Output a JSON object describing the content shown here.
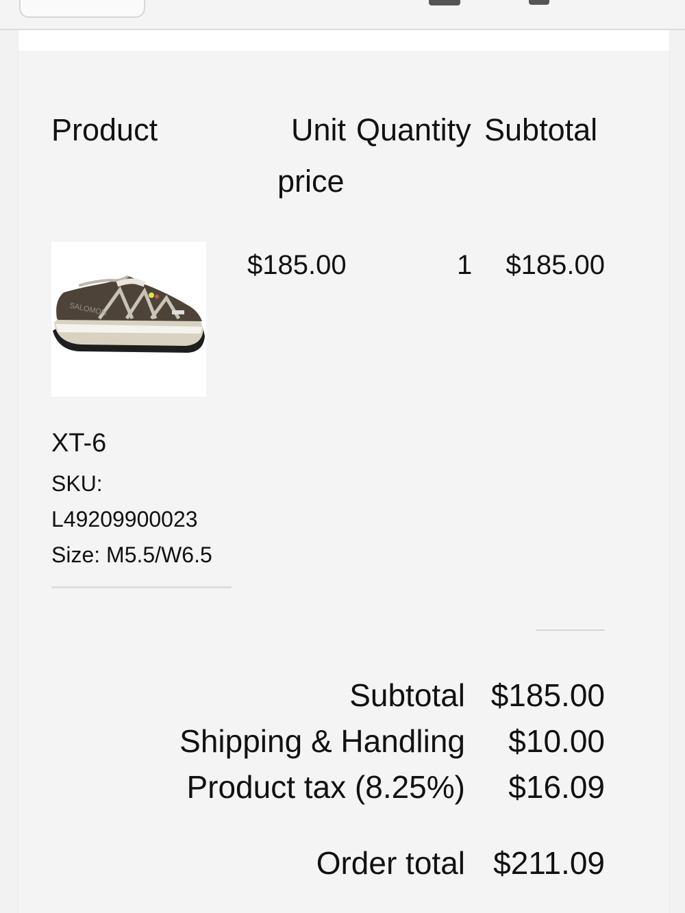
{
  "table": {
    "headers": {
      "product": "Product",
      "unit_price_line1": "Unit",
      "unit_price_line2": "price",
      "quantity": "Quantity",
      "subtotal": "Subtotal"
    }
  },
  "item": {
    "image_icon": "salomon-xt6-sneaker-image",
    "unit_price": "$185.00",
    "quantity": "1",
    "subtotal": "$185.00",
    "name": "XT-6",
    "sku_label": "SKU:",
    "sku_value": "L49209900023",
    "size": "Size: M5.5/W6.5"
  },
  "summary": {
    "subtotal_label": "Subtotal",
    "subtotal_value": "$185.00",
    "shipping_label": "Shipping & Handling",
    "shipping_value": "$10.00",
    "tax_label": "Product tax (8.25%)",
    "tax_value": "$16.09",
    "total_label": "Order total",
    "total_value": "$211.09"
  },
  "colors": {
    "background": "#f2f2f2",
    "panel": "#f4f4f4",
    "text": "#111111",
    "divider": "#dedede"
  }
}
